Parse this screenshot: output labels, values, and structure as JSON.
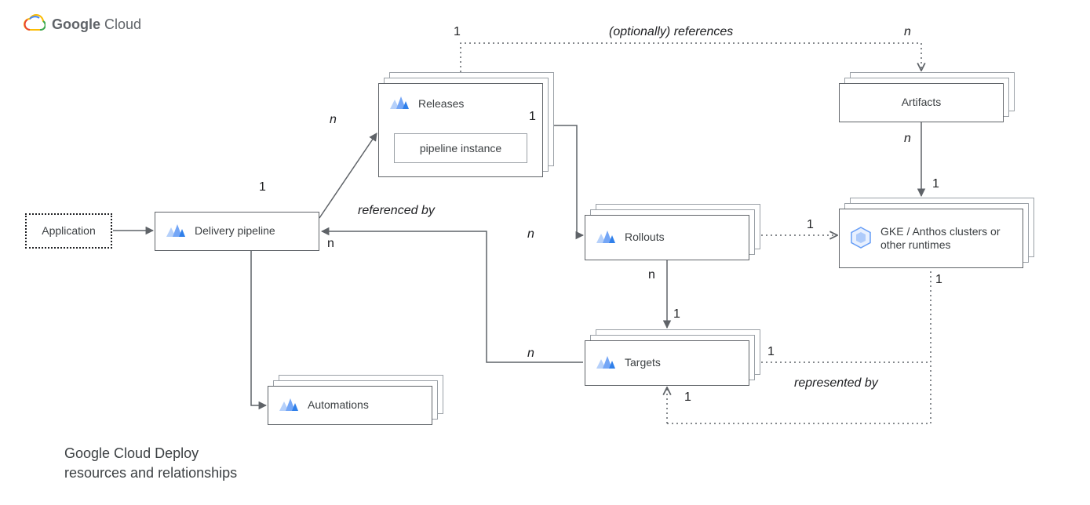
{
  "brand": {
    "strong": "Google",
    "light": "Cloud"
  },
  "caption": {
    "line1": "Google Cloud Deploy",
    "line2": "resources and relationships"
  },
  "nodes": {
    "application": "Application",
    "delivery_pipeline": "Delivery pipeline",
    "releases": "Releases",
    "pipeline_instance": "pipeline instance",
    "automations": "Automations",
    "rollouts": "Rollouts",
    "targets": "Targets",
    "artifacts": "Artifacts",
    "gke": "GKE / Anthos clusters or other runtimes"
  },
  "edge_labels": {
    "optionally_references": "(optionally) references",
    "referenced_by": "referenced by",
    "represented_by": "represented by"
  },
  "card": {
    "one_a": "1",
    "n_pipe_rel": "n",
    "one_rel_top": "1",
    "one_rel_right": "1",
    "n_rel_roll": "n",
    "n_roll": "n",
    "one_roll_targ": "1",
    "one_targ_below": "1",
    "n_refby": "n",
    "n_pipe_targ": "n",
    "one_targ_right": "1",
    "one_gke_left": "1",
    "one_gke_top": "1",
    "one_gke_bottom": "1",
    "n_art_top": "n",
    "n_art_bottom": "n"
  }
}
